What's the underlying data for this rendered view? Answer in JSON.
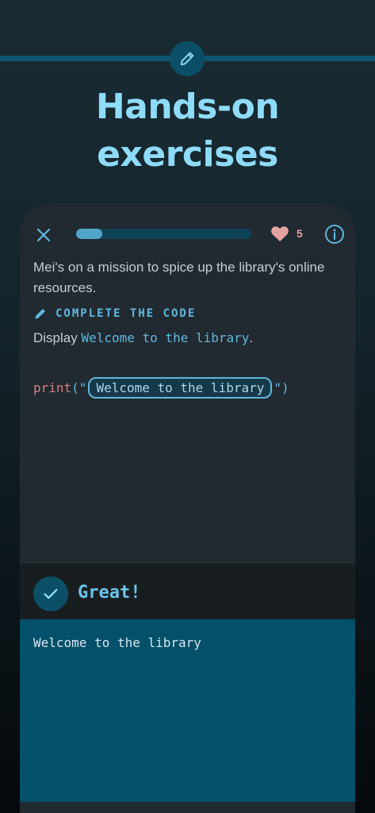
{
  "header": {
    "title": "Hands-on exercises",
    "title_line1": "Hands-on",
    "title_line2": "exercises",
    "badge_icon": "pencil-icon"
  },
  "exercise": {
    "progress": 0.15,
    "lives": "5",
    "intro": "Mei's on a mission to spice up the library's online resources.",
    "task_type": "COMPLETE THE CODE",
    "instruction_prefix": "Display ",
    "instruction_code": "Welcome to the library",
    "instruction_suffix": ".",
    "code": {
      "function": "print",
      "open": "(\"",
      "answer": "Welcome to the library",
      "close": "\")"
    }
  },
  "feedback": {
    "label": "Great!",
    "icon": "check-icon"
  },
  "output": {
    "text": "Welcome to the library"
  },
  "colors": {
    "accent": "#5fb8df",
    "headline": "#8fdcfa",
    "heart": "#e3a39e",
    "output_bg": "#025069"
  }
}
